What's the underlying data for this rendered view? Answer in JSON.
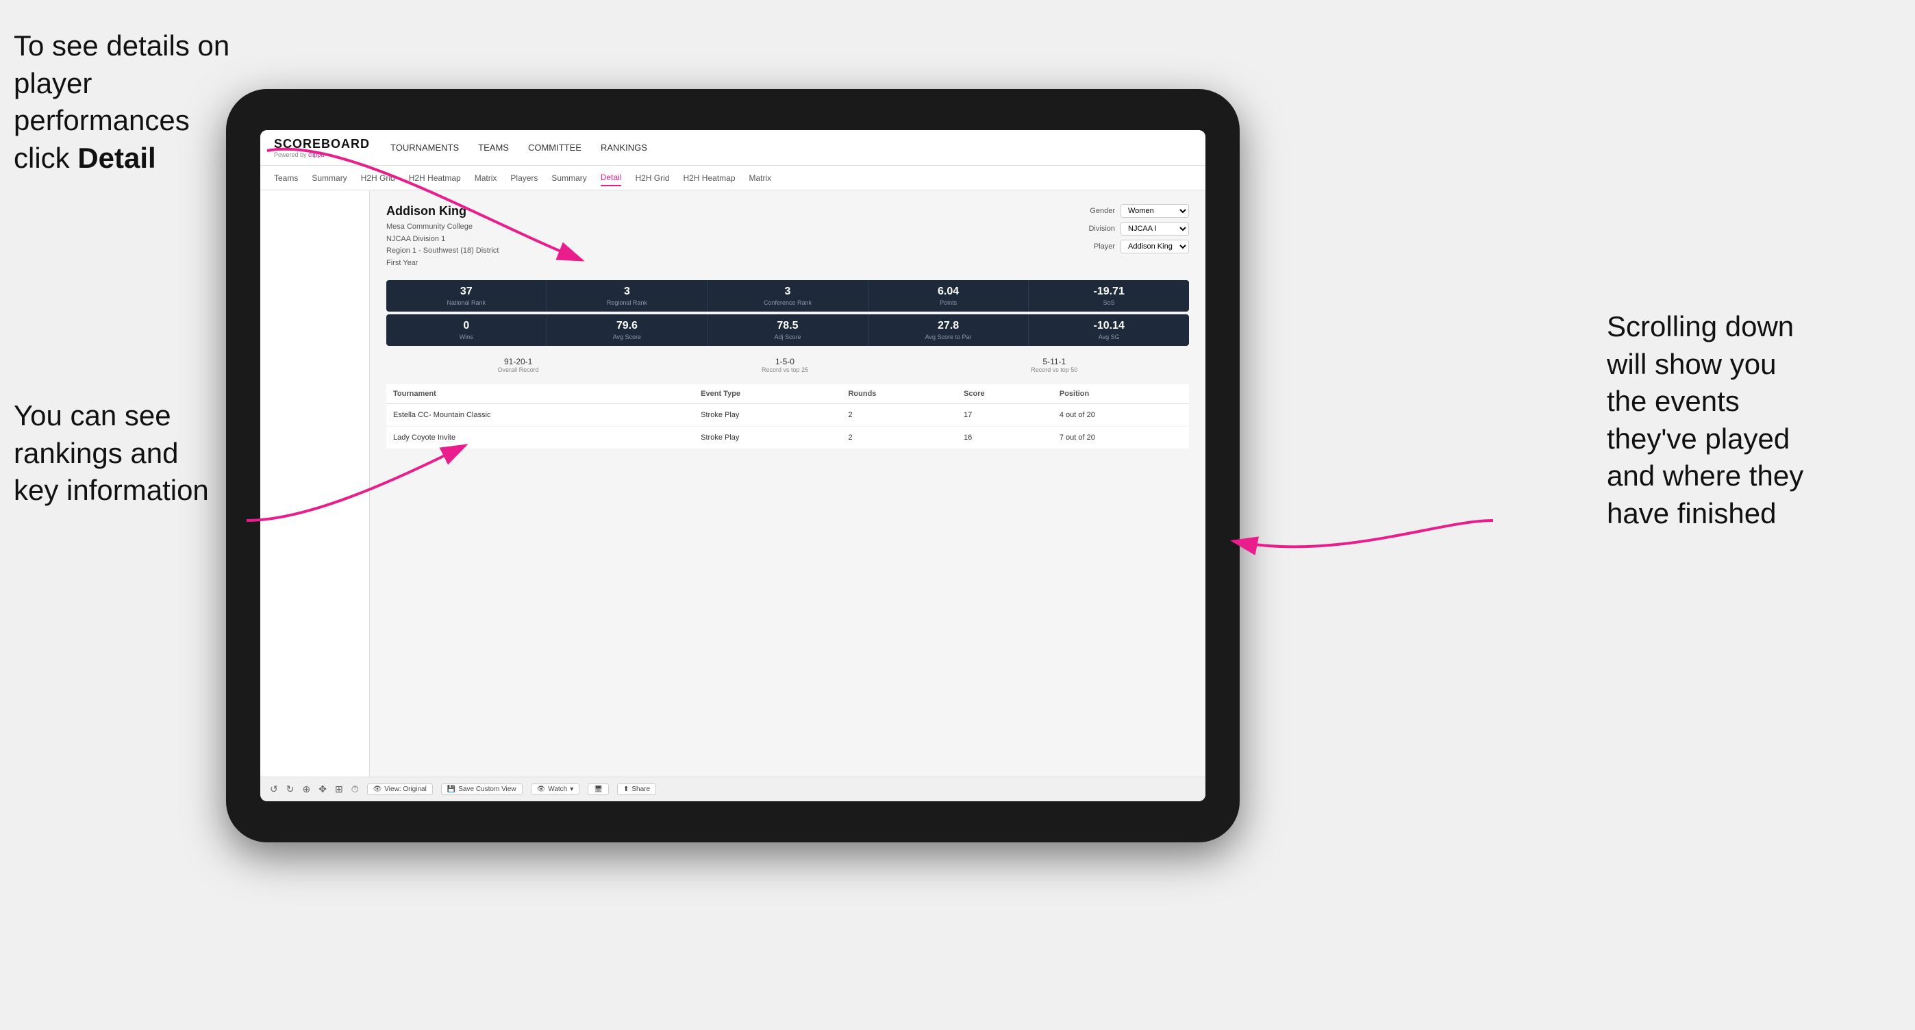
{
  "annotations": {
    "top_left": {
      "line1": "To see details on",
      "line2": "player performances",
      "line3_prefix": "click ",
      "line3_bold": "Detail"
    },
    "middle_left": {
      "line1": "You can see",
      "line2": "rankings and",
      "line3": "key information"
    },
    "right": {
      "line1": "Scrolling down",
      "line2": "will show you",
      "line3": "the events",
      "line4": "they've played",
      "line5": "and where they",
      "line6": "have finished"
    }
  },
  "nav": {
    "logo": "SCOREBOARD",
    "logo_sub": "Powered by ",
    "logo_brand": "clippd",
    "items": [
      {
        "label": "TOURNAMENTS",
        "active": false
      },
      {
        "label": "TEAMS",
        "active": false
      },
      {
        "label": "COMMITTEE",
        "active": false
      },
      {
        "label": "RANKINGS",
        "active": false
      }
    ]
  },
  "sub_nav": {
    "items": [
      {
        "label": "Teams",
        "active": false
      },
      {
        "label": "Summary",
        "active": false
      },
      {
        "label": "H2H Grid",
        "active": false
      },
      {
        "label": "H2H Heatmap",
        "active": false
      },
      {
        "label": "Matrix",
        "active": false
      },
      {
        "label": "Players",
        "active": false
      },
      {
        "label": "Summary",
        "active": false
      },
      {
        "label": "Detail",
        "active": true
      },
      {
        "label": "H2H Grid",
        "active": false
      },
      {
        "label": "H2H Heatmap",
        "active": false
      },
      {
        "label": "Matrix",
        "active": false
      }
    ]
  },
  "player": {
    "name": "Addison King",
    "college": "Mesa Community College",
    "division": "NJCAA Division 1",
    "region": "Region 1 - Southwest (18) District",
    "year": "First Year"
  },
  "controls": {
    "gender_label": "Gender",
    "gender_value": "Women",
    "division_label": "Division",
    "division_value": "NJCAA I",
    "player_label": "Player",
    "player_value": "Addison King"
  },
  "stats_row1": [
    {
      "value": "37",
      "label": "National Rank"
    },
    {
      "value": "3",
      "label": "Regional Rank"
    },
    {
      "value": "3",
      "label": "Conference Rank"
    },
    {
      "value": "6.04",
      "label": "Points"
    },
    {
      "value": "-19.71",
      "label": "SoS"
    }
  ],
  "stats_row2": [
    {
      "value": "0",
      "label": "Wins"
    },
    {
      "value": "79.6",
      "label": "Avg Score"
    },
    {
      "value": "78.5",
      "label": "Adj Score"
    },
    {
      "value": "27.8",
      "label": "Avg Score to Par"
    },
    {
      "value": "-10.14",
      "label": "Avg SG"
    }
  ],
  "records": [
    {
      "value": "91-20-1",
      "label": "Overall Record"
    },
    {
      "value": "1-5-0",
      "label": "Record vs top 25"
    },
    {
      "value": "5-11-1",
      "label": "Record vs top 50"
    }
  ],
  "table": {
    "headers": [
      "Tournament",
      "Event Type",
      "Rounds",
      "Score",
      "Position"
    ],
    "rows": [
      {
        "tournament": "Estella CC- Mountain Classic",
        "event_type": "Stroke Play",
        "rounds": "2",
        "score": "17",
        "position": "4 out of 20"
      },
      {
        "tournament": "Lady Coyote Invite",
        "event_type": "Stroke Play",
        "rounds": "2",
        "score": "16",
        "position": "7 out of 20"
      }
    ]
  },
  "toolbar": {
    "view_label": "View: Original",
    "save_label": "Save Custom View",
    "watch_label": "Watch",
    "share_label": "Share"
  }
}
